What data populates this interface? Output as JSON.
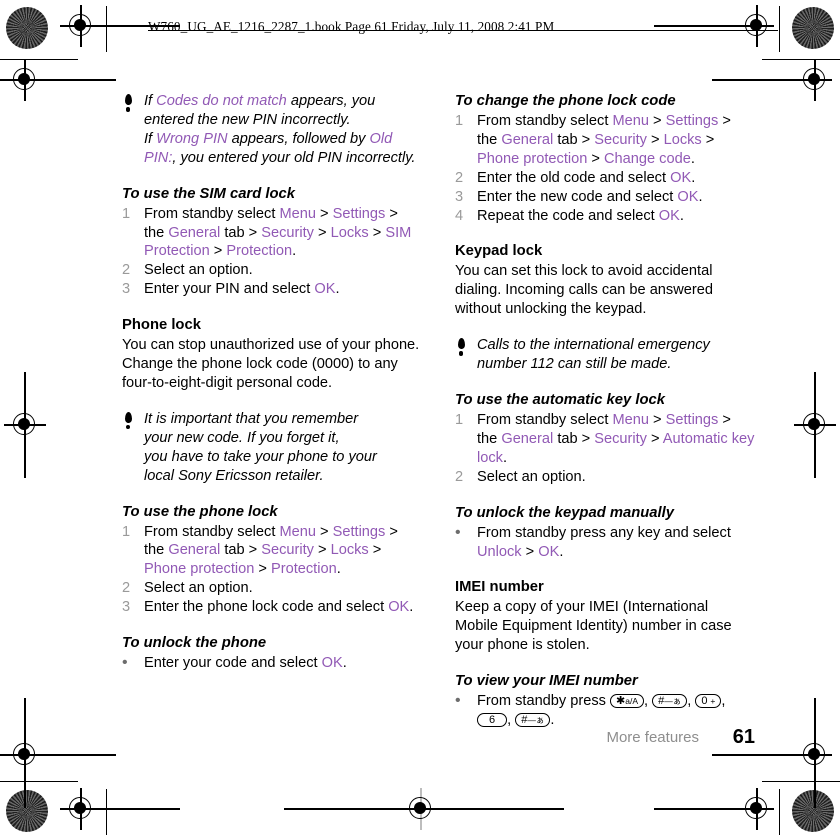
{
  "header": {
    "text": "W760_UG_AE_1216_2287_1.book  Page 61  Friday, July 11, 2008  2:41 PM"
  },
  "colors": {
    "ui_accent": "#9159b5",
    "step_number": "#9a9a9a",
    "footer_label": "#8e8e8e",
    "text": "#000000",
    "page_background": "#ffffff"
  },
  "left_column": {
    "note_1": {
      "segments": [
        {
          "text": "If ",
          "style": "italic"
        },
        {
          "text": "Codes do not match",
          "style": "ui"
        },
        {
          "text": " appears, you entered the new PIN incorrectly.",
          "style": "italic"
        },
        {
          "text": "If ",
          "style": "italic"
        },
        {
          "text": "Wrong PIN",
          "style": "ui"
        },
        {
          "text": " appears, followed by ",
          "style": "italic"
        },
        {
          "text": "Old PIN:",
          "style": "ui"
        },
        {
          "text": ", you entered your old PIN incorrectly.",
          "style": "italic"
        }
      ],
      "line_1_a": "If ",
      "line_1_ui": "Codes do not match",
      "line_1_b": " appears, you",
      "line_2": "entered the new PIN incorrectly.",
      "line_3_a": "If ",
      "line_3_ui": "Wrong PIN",
      "line_3_b": " appears, followed by ",
      "line_3_ui2": "Old",
      "line_4_ui": "PIN:",
      "line_4_b": ", you entered your old PIN incorrectly."
    },
    "sim_card_lock": {
      "heading": "To use the SIM card lock",
      "steps": [
        {
          "marker": "1",
          "parts": [
            {
              "t": "From standby select ",
              "s": "plain"
            },
            {
              "t": "Menu",
              "s": "ui"
            },
            {
              "t": " > ",
              "s": "plain"
            },
            {
              "t": "Settings",
              "s": "ui"
            },
            {
              "t": " > the ",
              "s": "plain"
            },
            {
              "t": "General",
              "s": "ui"
            },
            {
              "t": " tab > ",
              "s": "plain"
            },
            {
              "t": "Security",
              "s": "ui"
            },
            {
              "t": " > ",
              "s": "plain"
            },
            {
              "t": "Locks",
              "s": "ui"
            },
            {
              "t": " > ",
              "s": "plain"
            },
            {
              "t": "SIM Protection",
              "s": "ui"
            },
            {
              "t": " > ",
              "s": "plain"
            },
            {
              "t": "Protection",
              "s": "ui"
            },
            {
              "t": ".",
              "s": "plain"
            }
          ]
        },
        {
          "marker": "2",
          "parts": [
            {
              "t": "Select an option.",
              "s": "plain"
            }
          ]
        },
        {
          "marker": "3",
          "parts": [
            {
              "t": "Enter your PIN and select ",
              "s": "plain"
            },
            {
              "t": "OK",
              "s": "ui"
            },
            {
              "t": ".",
              "s": "plain"
            }
          ]
        }
      ]
    },
    "phone_lock": {
      "heading": "Phone lock",
      "body": "You can stop unauthorized use of your phone. Change the phone lock code (0000) to any four-to-eight-digit personal code."
    },
    "note_2": {
      "text": "It is important that you remember your new code. If you forget it, you have to take your phone to your local Sony Ericsson retailer.",
      "line_1": "It is important that you remember",
      "line_2": "your new code. If you forget it,",
      "line_3": "you have to take your phone to your",
      "line_4": "local Sony Ericsson retailer."
    },
    "use_phone_lock": {
      "heading": "To use the phone lock",
      "steps": [
        {
          "marker": "1",
          "parts": [
            {
              "t": "From standby select ",
              "s": "plain"
            },
            {
              "t": "Menu",
              "s": "ui"
            },
            {
              "t": " > ",
              "s": "plain"
            },
            {
              "t": "Settings",
              "s": "ui"
            },
            {
              "t": " > the ",
              "s": "plain"
            },
            {
              "t": "General",
              "s": "ui"
            },
            {
              "t": " tab > ",
              "s": "plain"
            },
            {
              "t": "Security",
              "s": "ui"
            },
            {
              "t": " > ",
              "s": "plain"
            },
            {
              "t": "Locks",
              "s": "ui"
            },
            {
              "t": " > ",
              "s": "plain"
            },
            {
              "t": "Phone protection",
              "s": "ui"
            },
            {
              "t": " > ",
              "s": "plain"
            },
            {
              "t": "Protection",
              "s": "ui"
            },
            {
              "t": ".",
              "s": "plain"
            }
          ]
        },
        {
          "marker": "2",
          "parts": [
            {
              "t": "Select an option.",
              "s": "plain"
            }
          ]
        },
        {
          "marker": "3",
          "parts": [
            {
              "t": "Enter the phone lock code and select ",
              "s": "plain"
            },
            {
              "t": "OK",
              "s": "ui"
            },
            {
              "t": ".",
              "s": "plain"
            }
          ]
        }
      ]
    },
    "unlock_phone": {
      "heading": "To unlock the phone",
      "steps": [
        {
          "marker": "•",
          "parts": [
            {
              "t": "Enter your code and select ",
              "s": "plain"
            },
            {
              "t": "OK",
              "s": "ui"
            },
            {
              "t": ".",
              "s": "plain"
            }
          ]
        }
      ]
    }
  },
  "right_column": {
    "change_lock_code": {
      "heading": "To change the phone lock code",
      "steps": [
        {
          "marker": "1",
          "parts": [
            {
              "t": "From standby select ",
              "s": "plain"
            },
            {
              "t": "Menu",
              "s": "ui"
            },
            {
              "t": " > ",
              "s": "plain"
            },
            {
              "t": "Settings",
              "s": "ui"
            },
            {
              "t": " > the ",
              "s": "plain"
            },
            {
              "t": "General",
              "s": "ui"
            },
            {
              "t": " tab > ",
              "s": "plain"
            },
            {
              "t": "Security",
              "s": "ui"
            },
            {
              "t": " > ",
              "s": "plain"
            },
            {
              "t": "Locks",
              "s": "ui"
            },
            {
              "t": " > ",
              "s": "plain"
            },
            {
              "t": "Phone protection",
              "s": "ui"
            },
            {
              "t": " > ",
              "s": "plain"
            },
            {
              "t": "Change code",
              "s": "ui"
            },
            {
              "t": ".",
              "s": "plain"
            }
          ]
        },
        {
          "marker": "2",
          "parts": [
            {
              "t": "Enter the old code and select ",
              "s": "plain"
            },
            {
              "t": "OK",
              "s": "ui"
            },
            {
              "t": ".",
              "s": "plain"
            }
          ]
        },
        {
          "marker": "3",
          "parts": [
            {
              "t": "Enter the new code and select ",
              "s": "plain"
            },
            {
              "t": "OK",
              "s": "ui"
            },
            {
              "t": ".",
              "s": "plain"
            }
          ]
        },
        {
          "marker": "4",
          "parts": [
            {
              "t": "Repeat the code and select ",
              "s": "plain"
            },
            {
              "t": "OK",
              "s": "ui"
            },
            {
              "t": ".",
              "s": "plain"
            }
          ]
        }
      ]
    },
    "keypad_lock": {
      "heading": "Keypad lock",
      "body": "You can set this lock to avoid accidental dialing. Incoming calls can be answered without unlocking the keypad."
    },
    "note_3": {
      "text": "Calls to the international emergency number 112 can still be made.",
      "line_1": "Calls to the international emergency",
      "line_2": "number 112 can still be made."
    },
    "auto_key_lock": {
      "heading": "To use the automatic key lock",
      "steps": [
        {
          "marker": "1",
          "parts": [
            {
              "t": "From standby select ",
              "s": "plain"
            },
            {
              "t": "Menu",
              "s": "ui"
            },
            {
              "t": " > ",
              "s": "plain"
            },
            {
              "t": "Settings",
              "s": "ui"
            },
            {
              "t": " > the ",
              "s": "plain"
            },
            {
              "t": "General",
              "s": "ui"
            },
            {
              "t": " tab > ",
              "s": "plain"
            },
            {
              "t": "Security",
              "s": "ui"
            },
            {
              "t": " > ",
              "s": "plain"
            },
            {
              "t": "Automatic key lock",
              "s": "ui"
            },
            {
              "t": ".",
              "s": "plain"
            }
          ]
        },
        {
          "marker": "2",
          "parts": [
            {
              "t": "Select an option.",
              "s": "plain"
            }
          ]
        }
      ]
    },
    "unlock_keypad": {
      "heading": "To unlock the keypad manually",
      "steps": [
        {
          "marker": "•",
          "parts": [
            {
              "t": "From standby press any key and select ",
              "s": "plain"
            },
            {
              "t": "Unlock",
              "s": "ui"
            },
            {
              "t": " > ",
              "s": "plain"
            },
            {
              "t": "OK",
              "s": "ui"
            },
            {
              "t": ".",
              "s": "plain"
            }
          ]
        }
      ]
    },
    "imei_number": {
      "heading": "IMEI number",
      "body": "Keep a copy of your IMEI (International Mobile Equipment Identity) number in case your phone is stolen."
    },
    "view_imei": {
      "heading": "To view your IMEI number",
      "marker": "•",
      "lead_text": "From standby press ",
      "keys": [
        {
          "main": "✱",
          "sub": "a/A"
        },
        {
          "main": "#",
          "sub": "—ぁ"
        },
        {
          "main": "0",
          "sub": "+"
        },
        {
          "main": "6",
          "sub": ""
        },
        {
          "main": "#",
          "sub": "—ぁ"
        }
      ],
      "separators": [
        ", ",
        ", ",
        ", ",
        ", "
      ],
      "trailing": "."
    }
  },
  "footer": {
    "section_label": "More features",
    "page_number": "61"
  }
}
